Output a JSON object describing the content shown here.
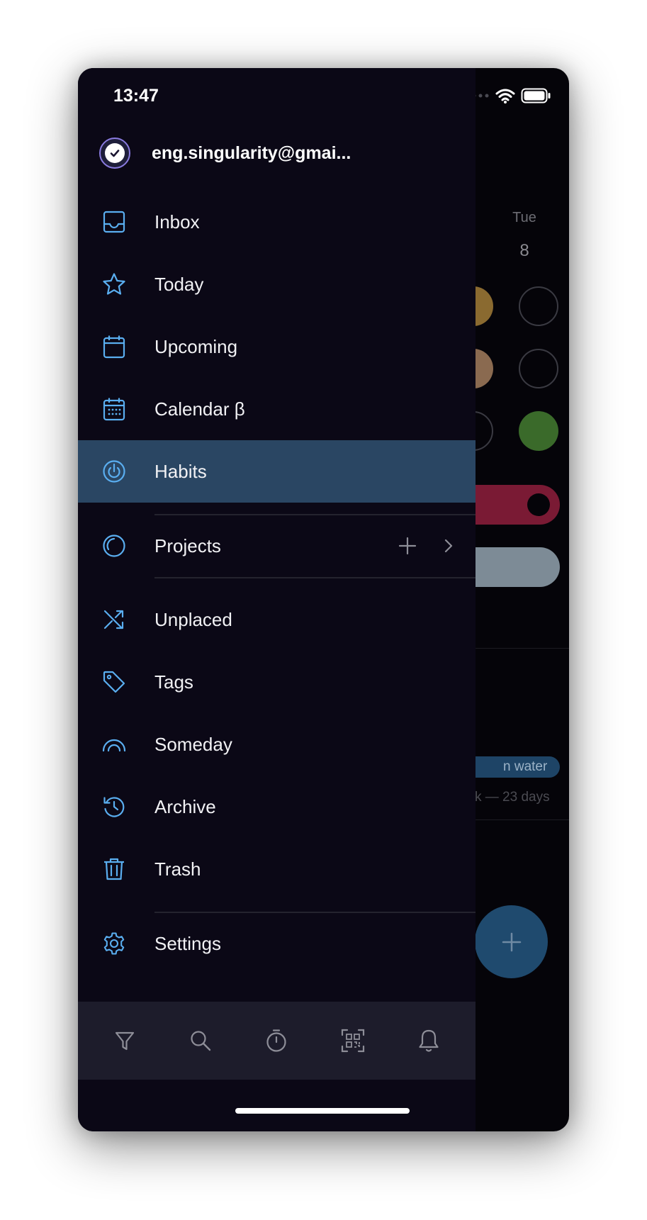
{
  "status_bar": {
    "time": "13:47"
  },
  "account": {
    "email": "eng.singularity@gmai..."
  },
  "menu": {
    "inbox": "Inbox",
    "today": "Today",
    "upcoming": "Upcoming",
    "calendar": "Calendar β",
    "habits": "Habits",
    "projects": "Projects",
    "unplaced": "Unplaced",
    "tags": "Tags",
    "someday": "Someday",
    "archive": "Archive",
    "trash": "Trash",
    "settings": "Settings"
  },
  "background": {
    "day_name": "Tue",
    "day_number": "8",
    "tag": "n water",
    "streak": "k — 23 days"
  },
  "colors": {
    "accent": "#5aaef0",
    "active_row": "#2a4663",
    "drawer_bg": "#0b0816",
    "bottom_bar_bg": "#1d1c2b"
  }
}
